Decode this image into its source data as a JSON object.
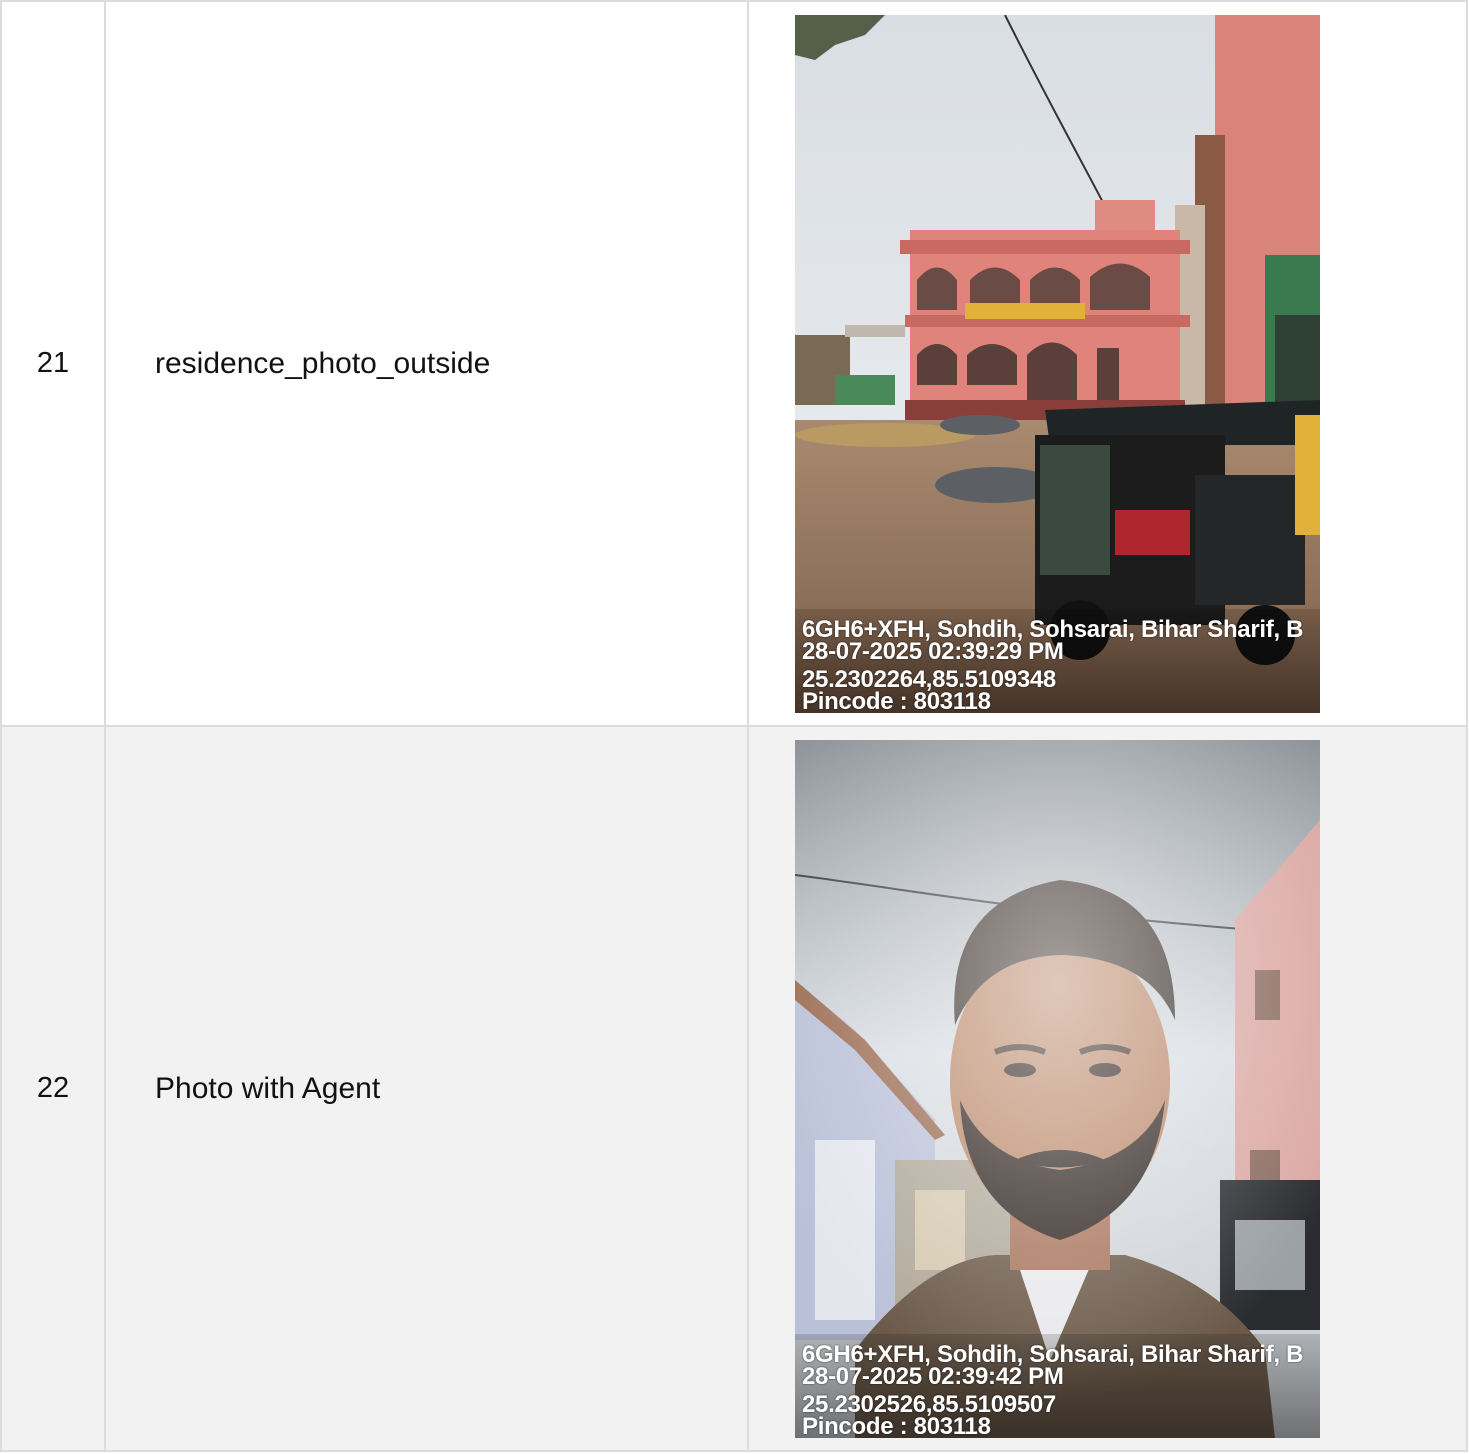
{
  "rows": [
    {
      "number": "21",
      "label": "residence_photo_outside",
      "photo": {
        "subject": "pink two-storey house with auto-rickshaw",
        "stamp": {
          "address": "6GH6+XFH, Sohdih, Sohsarai, Bihar Sharif, B",
          "datetime": "28-07-2025 02:39:29 PM",
          "coords": "25.2302264,85.5109348",
          "pincode": "Pincode : 803118"
        }
      }
    },
    {
      "number": "22",
      "label": "Photo with Agent",
      "photo": {
        "subject": "selfie of agent in street",
        "stamp": {
          "address": "6GH6+XFH, Sohdih, Sohsarai, Bihar Sharif, B",
          "datetime": "28-07-2025 02:39:42 PM",
          "coords": "25.2302526,85.5109507",
          "pincode": "Pincode : 803118"
        }
      }
    }
  ],
  "colors": {
    "border": "#dcdcdc",
    "row_alt_bg": "#f2f2f2",
    "stamp_text": "#ffffff"
  }
}
